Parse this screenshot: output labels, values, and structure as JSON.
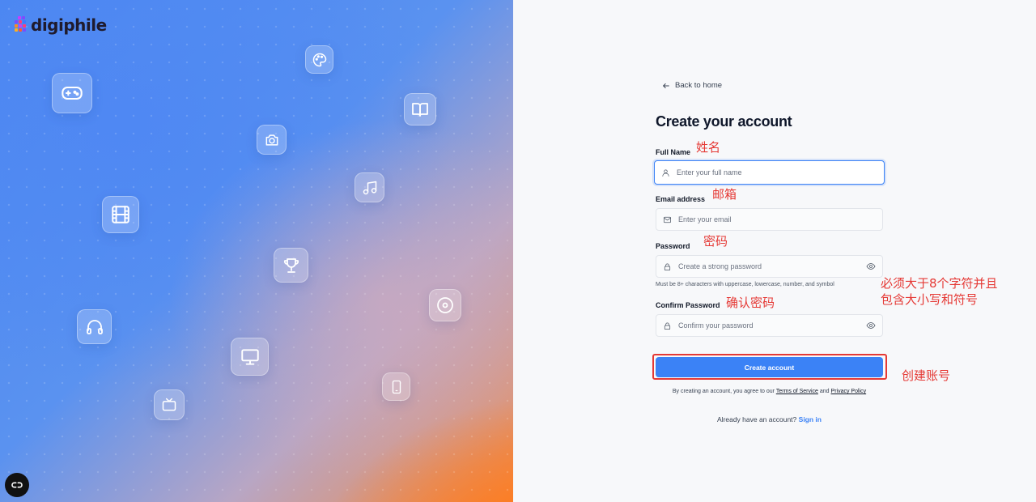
{
  "brand": {
    "name": "digiphile"
  },
  "hero": {
    "icons": [
      "gamepad-icon",
      "palette-icon",
      "camera-icon",
      "book-icon",
      "music-icon",
      "film-icon",
      "trophy-icon",
      "disc-icon",
      "headphones-icon",
      "monitor-icon",
      "tablet-icon",
      "tv-icon"
    ]
  },
  "nav": {
    "back_label": "Back to home"
  },
  "form": {
    "title": "Create your account",
    "full_name": {
      "label": "Full Name",
      "placeholder": "Enter your full name"
    },
    "email": {
      "label": "Email address",
      "placeholder": "Enter your email"
    },
    "password": {
      "label": "Password",
      "placeholder": "Create a strong password",
      "hint": "Must be 8+ characters with uppercase, lowercase, number, and symbol"
    },
    "confirm": {
      "label": "Confirm Password",
      "placeholder": "Confirm your password"
    },
    "submit_label": "Create account",
    "terms_prefix": "By creating an account, you agree to our",
    "terms_link": "Terms of Service",
    "terms_and": "and",
    "privacy_link": "Privacy Policy",
    "signin_prompt": "Already have an account?",
    "signin_link": "Sign in"
  },
  "annotations": {
    "name": "姓名",
    "email": "邮箱",
    "password": "密码",
    "password_rule_line1": "必须大于8个字符并且",
    "password_rule_line2": "包含大小写和符号",
    "confirm": "确认密码",
    "submit": "创建账号"
  },
  "colors": {
    "accent": "#3b82f6",
    "annotation": "#e53935",
    "hero_blue": "#4a86f2",
    "hero_orange": "#ff7a1a"
  }
}
